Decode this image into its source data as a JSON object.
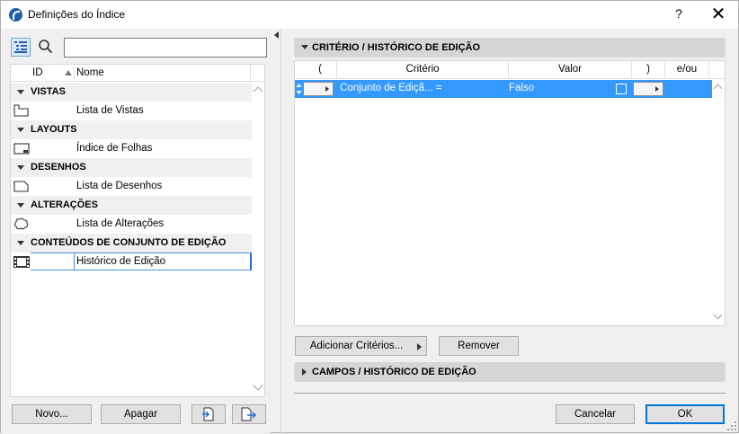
{
  "window": {
    "title": "Definições do Índice",
    "help_label": "?",
    "close_label": "✕"
  },
  "left": {
    "search_placeholder": "",
    "columns": {
      "id": "ID",
      "name": "Nome"
    },
    "groups": [
      {
        "label": "VISTAS",
        "item": "Lista de Vistas",
        "icon": "view-list-icon"
      },
      {
        "label": "LAYOUTS",
        "item": "Índice de Folhas",
        "icon": "layout-sheet-icon"
      },
      {
        "label": "DESENHOS",
        "item": "Lista de Desenhos",
        "icon": "drawing-list-icon"
      },
      {
        "label": "ALTERAÇÕES",
        "item": "Lista de Alterações",
        "icon": "change-cloud-icon"
      },
      {
        "label": "CONTEÚDOS DE CONJUNTO DE EDIÇÃO",
        "item": "Histórico de Edição",
        "icon": "issue-film-icon",
        "selected": true
      }
    ],
    "buttons": {
      "new": "Novo...",
      "delete": "Apagar"
    }
  },
  "right": {
    "criteria_section": "CRITÉRIO /  HISTÓRICO DE EDIÇÃO",
    "grid_headers": {
      "open_paren": "(",
      "criterion": "Critério",
      "value": "Valor",
      "close_paren": ")",
      "and_or": "e/ou"
    },
    "row": {
      "criterion": "Conjunto de Ediçã... =",
      "value": "Falso",
      "checked": false
    },
    "add_criteria": "Adicionar Critérios...",
    "remove": "Remover",
    "fields_section": "CAMPOS /  HISTÓRICO DE EDIÇÃO",
    "cancel": "Cancelar",
    "ok": "OK"
  },
  "colors": {
    "selection": "#3399ff",
    "selected_border": "#1e6fd0",
    "default_button_border": "#0078d7",
    "section_header": "#d6d6d6"
  }
}
